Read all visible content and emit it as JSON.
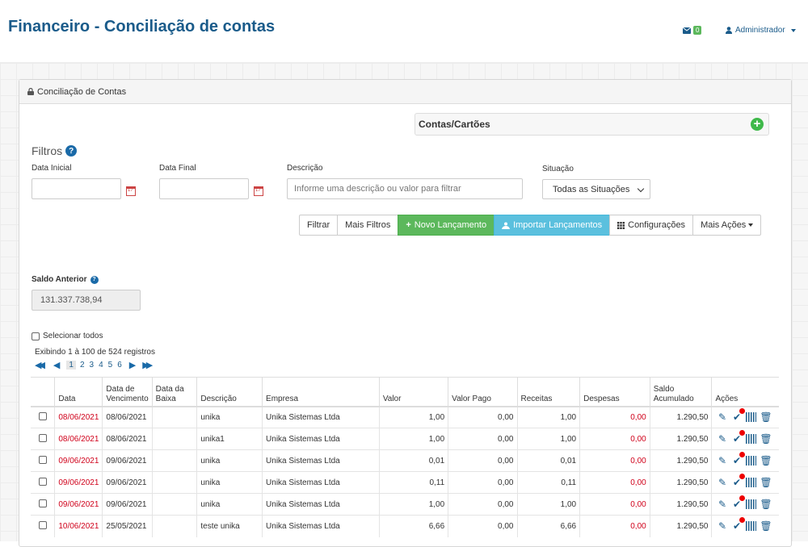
{
  "header": {
    "title": "Financeiro - Conciliação de contas",
    "mail_count": "0",
    "user": "Administrador"
  },
  "panel": {
    "title": "Conciliação de Contas",
    "contas_title": "Contas/Cartões"
  },
  "filters": {
    "title": "Filtros",
    "data_inicial_label": "Data Inicial",
    "data_final_label": "Data Final",
    "descricao_label": "Descrição",
    "descricao_placeholder": "Informe uma descrição ou valor para filtrar",
    "situacao_label": "Situação",
    "situacao_value": "Todas as Situações"
  },
  "toolbar": {
    "filtrar": "Filtrar",
    "mais_filtros": "Mais Filtros",
    "novo_lancamento": "Novo Lançamento",
    "importar": "Importar Lançamentos",
    "configuracoes": "Configurações",
    "mais_acoes": "Mais Ações"
  },
  "saldo": {
    "label": "Saldo Anterior",
    "value": "131.337.738,94"
  },
  "list": {
    "select_all": "Selecionar todos",
    "showing": "Exibindo 1 à 100 de 524 registros",
    "pages": [
      "1",
      "2",
      "3",
      "4",
      "5",
      "6"
    ]
  },
  "table": {
    "headers": {
      "data": "Data",
      "vencimento": "Data de Vencimento",
      "baixa": "Data da Baixa",
      "descricao": "Descrição",
      "empresa": "Empresa",
      "valor": "Valor",
      "valor_pago": "Valor Pago",
      "receitas": "Receitas",
      "despesas": "Despesas",
      "saldo": "Saldo Acumulado",
      "acoes": "Ações"
    },
    "rows": [
      {
        "data": "08/06/2021",
        "vencimento": "08/06/2021",
        "baixa": "",
        "descricao": "unika",
        "empresa": "Unika Sistemas Ltda",
        "valor": "1,00",
        "valor_pago": "0,00",
        "receitas": "1,00",
        "despesas": "0,00",
        "saldo": "1.290,50"
      },
      {
        "data": "08/06/2021",
        "vencimento": "08/06/2021",
        "baixa": "",
        "descricao": "unika1",
        "empresa": "Unika Sistemas Ltda",
        "valor": "1,00",
        "valor_pago": "0,00",
        "receitas": "1,00",
        "despesas": "0,00",
        "saldo": "1.290,50"
      },
      {
        "data": "09/06/2021",
        "vencimento": "09/06/2021",
        "baixa": "",
        "descricao": "unika",
        "empresa": "Unika Sistemas Ltda",
        "valor": "0,01",
        "valor_pago": "0,00",
        "receitas": "0,01",
        "despesas": "0,00",
        "saldo": "1.290,50"
      },
      {
        "data": "09/06/2021",
        "vencimento": "09/06/2021",
        "baixa": "",
        "descricao": "unika",
        "empresa": "Unika Sistemas Ltda",
        "valor": "0,11",
        "valor_pago": "0,00",
        "receitas": "0,11",
        "despesas": "0,00",
        "saldo": "1.290,50"
      },
      {
        "data": "09/06/2021",
        "vencimento": "09/06/2021",
        "baixa": "",
        "descricao": "unika",
        "empresa": "Unika Sistemas Ltda",
        "valor": "1,00",
        "valor_pago": "0,00",
        "receitas": "1,00",
        "despesas": "0,00",
        "saldo": "1.290,50"
      },
      {
        "data": "10/06/2021",
        "vencimento": "25/05/2021",
        "baixa": "",
        "descricao": "teste unika",
        "empresa": "Unika Sistemas Ltda",
        "valor": "6,66",
        "valor_pago": "0,00",
        "receitas": "6,66",
        "despesas": "0,00",
        "saldo": "1.290,50"
      }
    ]
  },
  "icons": {
    "mail": "envelope-icon",
    "user": "user-icon",
    "lock": "lock-icon",
    "add": "plus-circle-icon",
    "help": "question-circle-icon",
    "calendar": "calendar-icon",
    "edit": "pencil-icon",
    "check": "check-icon",
    "barcode": "barcode-icon",
    "delete": "trash-icon"
  },
  "colors": {
    "title": "#1a5b8a",
    "green": "#5cb85c",
    "teal": "#5bc0de",
    "red": "#d0021b",
    "add_green": "#3fb94a"
  }
}
